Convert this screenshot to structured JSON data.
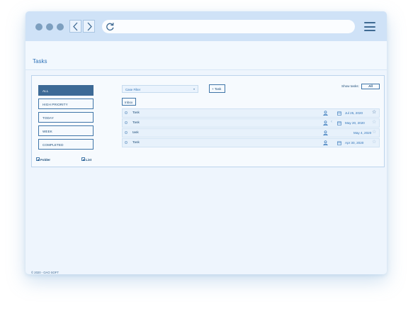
{
  "browser": {
    "dots": [
      "#7d9fbf",
      "#7d9fbf",
      "#7d9fbf"
    ],
    "icons": [
      "chevron-left-icon",
      "chevron-right-icon",
      "reload-icon",
      "hamburger-menu-icon"
    ]
  },
  "page": {
    "title": "Tasks"
  },
  "sidebar": {
    "filters": [
      {
        "label": "ALL",
        "active": true
      },
      {
        "label": "HIGH PRIORITY",
        "active": false
      },
      {
        "label": "TODAY",
        "active": false
      },
      {
        "label": "WEEK",
        "active": false
      },
      {
        "label": "COMPLETED",
        "active": false
      }
    ],
    "add_folder": "Folder",
    "add_list": "List"
  },
  "toolbar": {
    "case_filter_placeholder": "Case Filter",
    "add_task_label": "+ Task",
    "show_tasks_label": "Show tasks:",
    "show_all_label": "All",
    "inbox_label": "Inbox"
  },
  "tasks": [
    {
      "name": "Task",
      "date": "Jul 25, 2020",
      "has_back_icon": false,
      "starred": true
    },
    {
      "name": "Task",
      "date": "May 20, 2020",
      "has_back_icon": true,
      "starred": false
    },
    {
      "name": "task",
      "date": "May 4, 2020",
      "has_back_icon": false,
      "starred": false
    },
    {
      "name": "Task",
      "date": "Apr 30, 2020",
      "has_back_icon": false,
      "starred": false
    }
  ],
  "footer": {
    "text": "© 2020 - OAO SOFT"
  },
  "colors": {
    "accent": "#3d6a96",
    "chrome": "#cfe2f7",
    "background": "#eef5fd"
  }
}
